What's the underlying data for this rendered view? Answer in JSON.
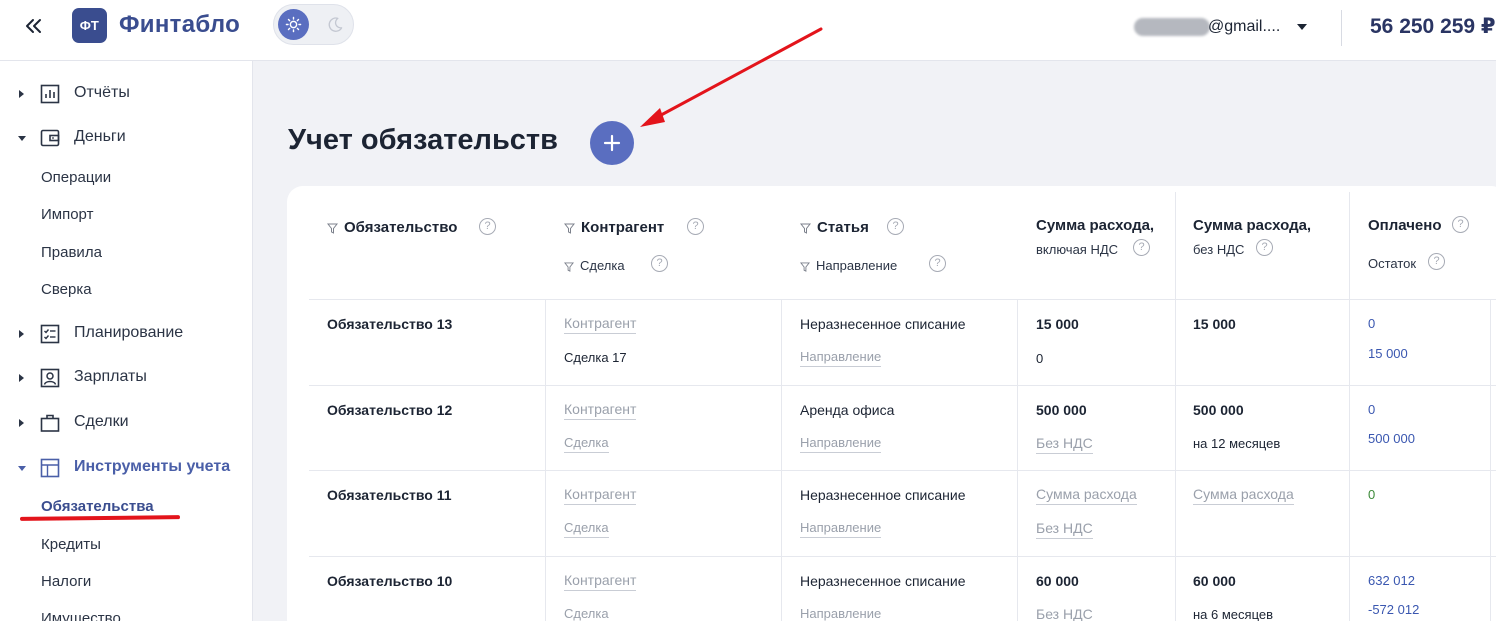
{
  "app": {
    "logo_badge": "ФТ",
    "logo_name": "Финтабло"
  },
  "topbar": {
    "user_email": "@gmail....",
    "balance": "56 250 259 ₽"
  },
  "sidebar": {
    "groups": [
      {
        "label": "Отчёты",
        "icon": "chart-icon"
      },
      {
        "label": "Деньги",
        "icon": "wallet-icon"
      },
      {
        "label": "Планирование",
        "icon": "plan-checklist-icon"
      },
      {
        "label": "Зарплаты",
        "icon": "person-card-icon"
      },
      {
        "label": "Сделки",
        "icon": "briefcase-icon"
      },
      {
        "label": "Инструменты учета",
        "icon": "table-icon"
      }
    ],
    "money_items": [
      "Операции",
      "Импорт",
      "Правила",
      "Сверка"
    ],
    "tools_items": [
      "Обязательства",
      "Кредиты",
      "Налоги",
      "Имущество"
    ]
  },
  "main": {
    "title": "Учет обязательств"
  },
  "table": {
    "headers": {
      "obligation": "Обязательство",
      "counterparty": "Контрагент",
      "deal": "Сделка",
      "article": "Статья",
      "direction": "Направление",
      "sum_vat_1": "Сумма расхода,",
      "sum_vat_2": "включая НДС",
      "sum_novat_1": "Сумма расхода,",
      "sum_novat_2": "без НДС",
      "paid": "Оплачено",
      "remaining": "Остаток"
    },
    "help_glyph": "?",
    "rows": [
      {
        "name": "Обязательство 13",
        "counterparty": "Контрагент",
        "deal": "Сделка 17",
        "article": "Неразнесенное списание",
        "direction": "Направление",
        "sum_vat": "15 000",
        "sum_vat_sub": "0",
        "sum_novat": "15 000",
        "sum_novat_sub": "",
        "paid": "0",
        "remaining": "15 000"
      },
      {
        "name": "Обязательство 12",
        "counterparty": "Контрагент",
        "deal": "Сделка",
        "article": "Аренда офиса",
        "direction": "Направление",
        "sum_vat": "500 000",
        "sum_vat_sub": "Без НДС",
        "sum_novat": "500 000",
        "sum_novat_sub": "на 12 месяцев",
        "paid": "0",
        "remaining": "500 000"
      },
      {
        "name": "Обязательство 11",
        "counterparty": "Контрагент",
        "deal": "Сделка",
        "article": "Неразнесенное списание",
        "direction": "Направление",
        "sum_vat": "Сумма расхода",
        "sum_vat_sub": "Без НДС",
        "sum_novat": "Сумма расхода",
        "sum_novat_sub": "",
        "paid": "0",
        "remaining": ""
      },
      {
        "name": "Обязательство 10",
        "counterparty": "Контрагент",
        "deal": "Сделка",
        "article": "Неразнесенное списание",
        "direction": "Направление",
        "sum_vat": "60 000",
        "sum_vat_sub": "Без НДС",
        "sum_novat": "60 000",
        "sum_novat_sub": "на 6 месяцев",
        "paid": "632 012",
        "remaining": "-572 012"
      }
    ]
  },
  "colors": {
    "brand": "#3a4d8f",
    "accent": "#5a6ec0",
    "link": "#3a57b0",
    "paid_zero": "#3d8a3a",
    "annotation": "#e3141b"
  }
}
